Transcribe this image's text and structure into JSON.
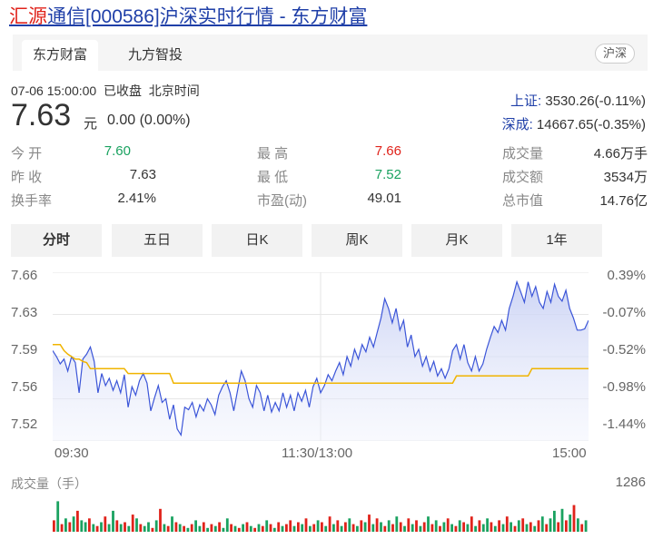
{
  "page": {
    "title_highlight": "汇源",
    "title_rest": "通信[000586]沪深实时行情 - 东方财富"
  },
  "tabs": [
    {
      "label": "东方财富"
    },
    {
      "label": "九方智投"
    }
  ],
  "market_badge": "沪深",
  "quote": {
    "timestamp": "07-06 15:00:00",
    "status": "已收盘",
    "timezone": "北京时间",
    "price": "7.63",
    "unit": "元",
    "change": "0.00 (0.00%)"
  },
  "indices": [
    {
      "label": "上证:",
      "value": "3530.26(-0.11%)"
    },
    {
      "label": "深成:",
      "value": "14667.65(-0.35%)"
    }
  ],
  "stats": {
    "open_label": "今  开",
    "open": "7.60",
    "high_label": "最  高",
    "high": "7.66",
    "volume_label": "成交量",
    "volume": "4.66万手",
    "prev_label": "昨  收",
    "prev": "7.63",
    "low_label": "最  低",
    "low": "7.52",
    "amount_label": "成交额",
    "amount": "3534万",
    "turnover_label": "换手率",
    "turnover": "2.41%",
    "pe_label": "市盈(动)",
    "pe": "49.01",
    "mktcap_label": "总市值",
    "mktcap": "14.76亿"
  },
  "periods": [
    "分时",
    "五日",
    "日K",
    "周K",
    "月K",
    "1年"
  ],
  "colors": {
    "up": "#e0231b",
    "down": "#1aa260",
    "price_line": "#3b55d8",
    "avg_line": "#f0b400",
    "link": "#1f3fa8"
  },
  "chart_data": {
    "type": "line",
    "y_price_ticks": [
      "7.66",
      "7.63",
      "7.59",
      "7.56",
      "7.52"
    ],
    "y_pct_ticks": [
      "0.39%",
      "-0.07%",
      "-0.52%",
      "-0.98%",
      "-1.44%"
    ],
    "x_ticks": [
      "09:30",
      "11:30/13:00",
      "15:00"
    ],
    "ylim": [
      7.52,
      7.66
    ],
    "series": [
      {
        "values": [
          7.595,
          7.59,
          7.584,
          7.588,
          7.578,
          7.59,
          7.585,
          7.56,
          7.588,
          7.592,
          7.598,
          7.586,
          7.56,
          7.576,
          7.566,
          7.572,
          7.562,
          7.57,
          7.56,
          7.575,
          7.548,
          7.565,
          7.558,
          7.57,
          7.576,
          7.568,
          7.545,
          7.556,
          7.566,
          7.552,
          7.555,
          7.538,
          7.55,
          7.53,
          7.525,
          7.548,
          7.546,
          7.552,
          7.54,
          7.55,
          7.545,
          7.555,
          7.55,
          7.542,
          7.558,
          7.565,
          7.57,
          7.56,
          7.545,
          7.562,
          7.578,
          7.57,
          7.555,
          7.548,
          7.566,
          7.56,
          7.545,
          7.558,
          7.544,
          7.552,
          7.545,
          7.56,
          7.548,
          7.558,
          7.545,
          7.56,
          7.553,
          7.562,
          7.548,
          7.565,
          7.572,
          7.56,
          7.566,
          7.575,
          7.57,
          7.578,
          7.585,
          7.575,
          7.59,
          7.582,
          7.596,
          7.588,
          7.6,
          7.594,
          7.606,
          7.598,
          7.61,
          7.622,
          7.638,
          7.63,
          7.618,
          7.63,
          7.612,
          7.62,
          7.598,
          7.608,
          7.59,
          7.596,
          7.582,
          7.59,
          7.578,
          7.586,
          7.574,
          7.58,
          7.572,
          7.58,
          7.595,
          7.6,
          7.588,
          7.6,
          7.585,
          7.578,
          7.59,
          7.578,
          7.584,
          7.596,
          7.606,
          7.615,
          7.61,
          7.62,
          7.612,
          7.63,
          7.64,
          7.652,
          7.644,
          7.635,
          7.652,
          7.64,
          7.648,
          7.635,
          7.63,
          7.644,
          7.635,
          7.65,
          7.64,
          7.636,
          7.645,
          7.63,
          7.622,
          7.612,
          7.612,
          7.613,
          7.62
        ],
        "color": "#3b55d8"
      },
      {
        "values": [
          7.6,
          7.6,
          7.6,
          7.595,
          7.592,
          7.59,
          7.588,
          7.588,
          7.586,
          7.585,
          7.58,
          7.58,
          7.58,
          7.58,
          7.58,
          7.58,
          7.58,
          7.58,
          7.58,
          7.58,
          7.576,
          7.576,
          7.576,
          7.576,
          7.576,
          7.576,
          7.576,
          7.576,
          7.576,
          7.576,
          7.576,
          7.576,
          7.568,
          7.568,
          7.568,
          7.568,
          7.568,
          7.568,
          7.568,
          7.568,
          7.568,
          7.568,
          7.568,
          7.568,
          7.568,
          7.568,
          7.568,
          7.568,
          7.568,
          7.568,
          7.568,
          7.568,
          7.568,
          7.568,
          7.568,
          7.568,
          7.568,
          7.568,
          7.568,
          7.568,
          7.568,
          7.568,
          7.568,
          7.568,
          7.568,
          7.568,
          7.568,
          7.568,
          7.568,
          7.568,
          7.568,
          7.568,
          7.568,
          7.568,
          7.568,
          7.568,
          7.568,
          7.568,
          7.568,
          7.568,
          7.568,
          7.568,
          7.568,
          7.568,
          7.568,
          7.568,
          7.568,
          7.568,
          7.568,
          7.568,
          7.568,
          7.568,
          7.568,
          7.568,
          7.568,
          7.568,
          7.568,
          7.568,
          7.568,
          7.568,
          7.568,
          7.568,
          7.568,
          7.568,
          7.568,
          7.568,
          7.568,
          7.574,
          7.574,
          7.574,
          7.574,
          7.574,
          7.574,
          7.574,
          7.574,
          7.574,
          7.574,
          7.574,
          7.574,
          7.574,
          7.574,
          7.574,
          7.574,
          7.574,
          7.574,
          7.574,
          7.574,
          7.58,
          7.58,
          7.58,
          7.58,
          7.58,
          7.58,
          7.58,
          7.58,
          7.58,
          7.58,
          7.58,
          7.58,
          7.58,
          7.58,
          7.58,
          7.58
        ],
        "color": "#f0b400"
      }
    ],
    "volume_max_label": "1286",
    "volume_label": "成交量（手）",
    "volume": [
      {
        "v": 0.3,
        "c": "r"
      },
      {
        "v": 0.8,
        "c": "g"
      },
      {
        "v": 0.2,
        "c": "r"
      },
      {
        "v": 0.35,
        "c": "g"
      },
      {
        "v": 0.25,
        "c": "r"
      },
      {
        "v": 0.4,
        "c": "g"
      },
      {
        "v": 0.55,
        "c": "r"
      },
      {
        "v": 0.3,
        "c": "g"
      },
      {
        "v": 0.25,
        "c": "g"
      },
      {
        "v": 0.35,
        "c": "r"
      },
      {
        "v": 0.2,
        "c": "g"
      },
      {
        "v": 0.15,
        "c": "r"
      },
      {
        "v": 0.25,
        "c": "g"
      },
      {
        "v": 0.4,
        "c": "r"
      },
      {
        "v": 0.2,
        "c": "g"
      },
      {
        "v": 0.55,
        "c": "g"
      },
      {
        "v": 0.3,
        "c": "r"
      },
      {
        "v": 0.2,
        "c": "g"
      },
      {
        "v": 0.25,
        "c": "r"
      },
      {
        "v": 0.15,
        "c": "g"
      },
      {
        "v": 0.45,
        "c": "r"
      },
      {
        "v": 0.35,
        "c": "g"
      },
      {
        "v": 0.2,
        "c": "r"
      },
      {
        "v": 0.15,
        "c": "g"
      },
      {
        "v": 0.25,
        "c": "g"
      },
      {
        "v": 0.1,
        "c": "r"
      },
      {
        "v": 0.3,
        "c": "g"
      },
      {
        "v": 0.6,
        "c": "r"
      },
      {
        "v": 0.2,
        "c": "g"
      },
      {
        "v": 0.15,
        "c": "r"
      },
      {
        "v": 0.4,
        "c": "g"
      },
      {
        "v": 0.25,
        "c": "r"
      },
      {
        "v": 0.2,
        "c": "g"
      },
      {
        "v": 0.15,
        "c": "r"
      },
      {
        "v": 0.1,
        "c": "g"
      },
      {
        "v": 0.2,
        "c": "r"
      },
      {
        "v": 0.3,
        "c": "g"
      },
      {
        "v": 0.15,
        "c": "g"
      },
      {
        "v": 0.25,
        "c": "r"
      },
      {
        "v": 0.1,
        "c": "g"
      },
      {
        "v": 0.2,
        "c": "r"
      },
      {
        "v": 0.15,
        "c": "g"
      },
      {
        "v": 0.25,
        "c": "r"
      },
      {
        "v": 0.1,
        "c": "g"
      },
      {
        "v": 0.35,
        "c": "g"
      },
      {
        "v": 0.2,
        "c": "r"
      },
      {
        "v": 0.15,
        "c": "g"
      },
      {
        "v": 0.1,
        "c": "r"
      },
      {
        "v": 0.2,
        "c": "g"
      },
      {
        "v": 0.25,
        "c": "r"
      },
      {
        "v": 0.15,
        "c": "g"
      },
      {
        "v": 0.1,
        "c": "r"
      },
      {
        "v": 0.2,
        "c": "g"
      },
      {
        "v": 0.15,
        "c": "r"
      },
      {
        "v": 0.3,
        "c": "g"
      },
      {
        "v": 0.2,
        "c": "r"
      },
      {
        "v": 0.1,
        "c": "g"
      },
      {
        "v": 0.25,
        "c": "r"
      },
      {
        "v": 0.15,
        "c": "g"
      },
      {
        "v": 0.2,
        "c": "r"
      },
      {
        "v": 0.3,
        "c": "r"
      },
      {
        "v": 0.15,
        "c": "g"
      },
      {
        "v": 0.25,
        "c": "r"
      },
      {
        "v": 0.2,
        "c": "g"
      },
      {
        "v": 0.35,
        "c": "r"
      },
      {
        "v": 0.15,
        "c": "g"
      },
      {
        "v": 0.2,
        "c": "r"
      },
      {
        "v": 0.3,
        "c": "g"
      },
      {
        "v": 0.25,
        "c": "r"
      },
      {
        "v": 0.15,
        "c": "g"
      },
      {
        "v": 0.4,
        "c": "r"
      },
      {
        "v": 0.2,
        "c": "g"
      },
      {
        "v": 0.3,
        "c": "r"
      },
      {
        "v": 0.15,
        "c": "g"
      },
      {
        "v": 0.25,
        "c": "r"
      },
      {
        "v": 0.35,
        "c": "g"
      },
      {
        "v": 0.2,
        "c": "r"
      },
      {
        "v": 0.15,
        "c": "g"
      },
      {
        "v": 0.3,
        "c": "r"
      },
      {
        "v": 0.25,
        "c": "g"
      },
      {
        "v": 0.45,
        "c": "r"
      },
      {
        "v": 0.2,
        "c": "g"
      },
      {
        "v": 0.35,
        "c": "r"
      },
      {
        "v": 0.25,
        "c": "g"
      },
      {
        "v": 0.15,
        "c": "r"
      },
      {
        "v": 0.3,
        "c": "g"
      },
      {
        "v": 0.2,
        "c": "r"
      },
      {
        "v": 0.4,
        "c": "g"
      },
      {
        "v": 0.25,
        "c": "r"
      },
      {
        "v": 0.15,
        "c": "g"
      },
      {
        "v": 0.35,
        "c": "r"
      },
      {
        "v": 0.2,
        "c": "g"
      },
      {
        "v": 0.3,
        "c": "r"
      },
      {
        "v": 0.15,
        "c": "g"
      },
      {
        "v": 0.25,
        "c": "r"
      },
      {
        "v": 0.4,
        "c": "g"
      },
      {
        "v": 0.2,
        "c": "r"
      },
      {
        "v": 0.3,
        "c": "g"
      },
      {
        "v": 0.15,
        "c": "r"
      },
      {
        "v": 0.25,
        "c": "g"
      },
      {
        "v": 0.35,
        "c": "r"
      },
      {
        "v": 0.2,
        "c": "g"
      },
      {
        "v": 0.15,
        "c": "r"
      },
      {
        "v": 0.3,
        "c": "g"
      },
      {
        "v": 0.25,
        "c": "r"
      },
      {
        "v": 0.2,
        "c": "g"
      },
      {
        "v": 0.4,
        "c": "r"
      },
      {
        "v": 0.15,
        "c": "g"
      },
      {
        "v": 0.3,
        "c": "r"
      },
      {
        "v": 0.2,
        "c": "g"
      },
      {
        "v": 0.35,
        "c": "g"
      },
      {
        "v": 0.25,
        "c": "r"
      },
      {
        "v": 0.15,
        "c": "g"
      },
      {
        "v": 0.3,
        "c": "r"
      },
      {
        "v": 0.2,
        "c": "g"
      },
      {
        "v": 0.4,
        "c": "r"
      },
      {
        "v": 0.25,
        "c": "g"
      },
      {
        "v": 0.15,
        "c": "r"
      },
      {
        "v": 0.3,
        "c": "g"
      },
      {
        "v": 0.35,
        "c": "r"
      },
      {
        "v": 0.2,
        "c": "g"
      },
      {
        "v": 0.25,
        "c": "r"
      },
      {
        "v": 0.15,
        "c": "g"
      },
      {
        "v": 0.3,
        "c": "r"
      },
      {
        "v": 0.4,
        "c": "g"
      },
      {
        "v": 0.2,
        "c": "r"
      },
      {
        "v": 0.35,
        "c": "g"
      },
      {
        "v": 0.55,
        "c": "g"
      },
      {
        "v": 0.25,
        "c": "r"
      },
      {
        "v": 0.6,
        "c": "g"
      },
      {
        "v": 0.3,
        "c": "r"
      },
      {
        "v": 0.45,
        "c": "g"
      },
      {
        "v": 0.7,
        "c": "r"
      },
      {
        "v": 0.35,
        "c": "g"
      },
      {
        "v": 0.2,
        "c": "r"
      },
      {
        "v": 0.3,
        "c": "g"
      }
    ]
  }
}
